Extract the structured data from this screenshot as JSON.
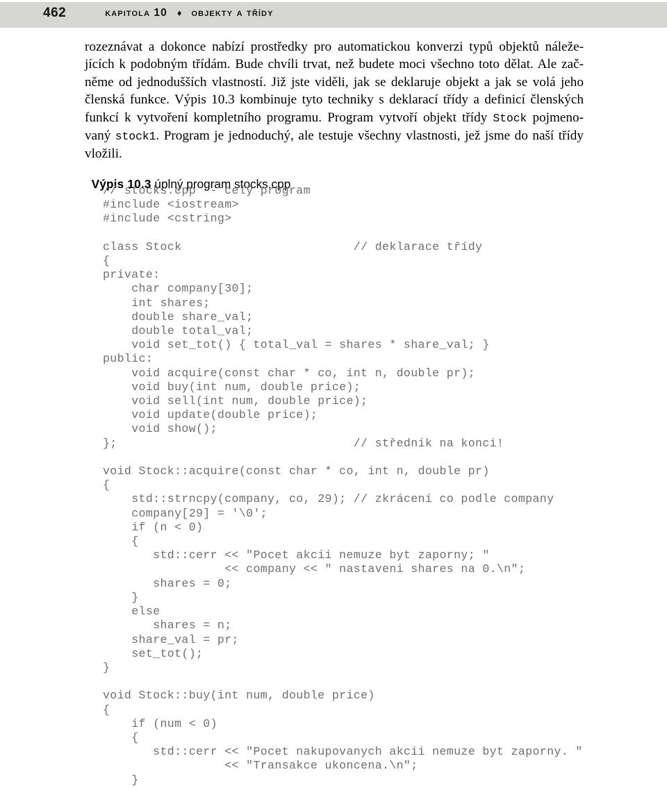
{
  "header": {
    "page_number": "462",
    "chapter_label": "Kapitola 10",
    "separator_icon": "diamond-icon",
    "separator_glyph": "♦",
    "chapter_subject": "Objekty a třídy",
    "background_color": "#d6d6d4"
  },
  "body": {
    "lines": [
      "rozeznávat a dokonce nabízí prostředky pro automatickou konverzi typů objektů náleže-",
      "jících k podobným třídám. Bude chvíli trvat, než budete moci všechno toto dělat. Ale zač-",
      "něme od jednodušších vlastností. Již jste viděli, jak se deklaruje objekt a jak se volá jeho",
      "členská funkce. Výpis 10.3 kombinuje tyto techniky s deklarací třídy a definicí členských",
      "funkcí k vytvoření kompletního programu. Program vytvoří objekt třídy ",
      " pojmeno-",
      "vaný ",
      ". Program je jednoduchý, ale testuje všechny vlastnosti, jež jsme do naší třídy",
      "vložili."
    ],
    "inline_code_1": "Stock",
    "inline_code_2": "stock1"
  },
  "listing": {
    "caption_strong": "Výpis 10.3",
    "caption_rest": " úplný program stocks.cpp",
    "code_color": "#6f6f6f",
    "code_lines": [
      "// stocks.cpp -- celý program",
      "#include <iostream>",
      "#include <cstring>",
      "",
      "class Stock                        // deklarace třídy",
      "{",
      "private:",
      "    char company[30];",
      "    int shares;",
      "    double share_val;",
      "    double total_val;",
      "    void set_tot() { total_val = shares * share_val; }",
      "public:",
      "    void acquire(const char * co, int n, double pr);",
      "    void buy(int num, double price);",
      "    void sell(int num, double price);",
      "    void update(double price);",
      "    void show();",
      "};                                 // středník na konci!",
      "",
      "void Stock::acquire(const char * co, int n, double pr)",
      "{",
      "    std::strncpy(company, co, 29); // zkrácení co podle company",
      "    company[29] = '\\0';",
      "    if (n < 0)",
      "    {",
      "       std::cerr << \"Pocet akcii nemuze byt zaporny; \"",
      "                 << company << \" nastaveni shares na 0.\\n\";",
      "       shares = 0;",
      "    }",
      "    else",
      "       shares = n;",
      "    share_val = pr;",
      "    set_tot();",
      "}",
      "",
      "void Stock::buy(int num, double price)",
      "{",
      "    if (num < 0)",
      "    {",
      "       std::cerr << \"Pocet nakupovanych akcii nemuze byt zaporny. \"",
      "                 << \"Transakce ukoncena.\\n\";",
      "    }"
    ]
  }
}
